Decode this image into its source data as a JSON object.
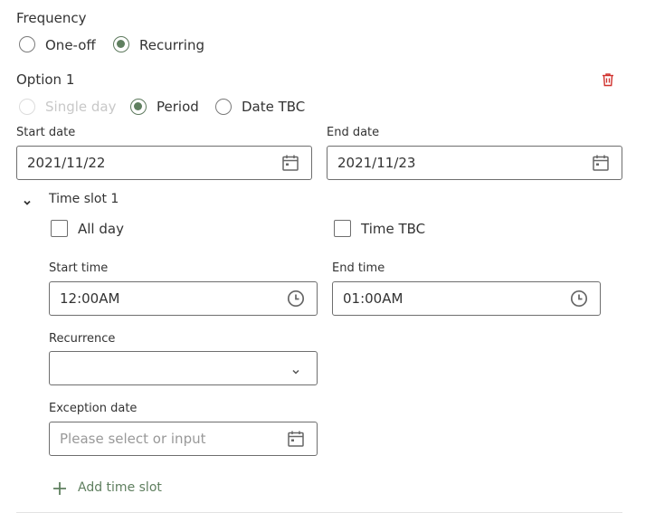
{
  "frequency": {
    "title": "Frequency",
    "options": [
      {
        "label": "One-off",
        "checked": false
      },
      {
        "label": "Recurring",
        "checked": true
      }
    ]
  },
  "option": {
    "title": "Option 1",
    "delete_icon": "trash-icon",
    "day_types": [
      {
        "label": "Single day",
        "checked": false,
        "disabled": true
      },
      {
        "label": "Period",
        "checked": true,
        "disabled": false
      },
      {
        "label": "Date TBC",
        "checked": false,
        "disabled": false
      }
    ],
    "start_date": {
      "label": "Start date",
      "value": "2021/11/22",
      "icon": "calendar-icon"
    },
    "end_date": {
      "label": "End date",
      "value": "2021/11/23",
      "icon": "calendar-icon"
    }
  },
  "time_slot": {
    "title": "Time slot 1",
    "all_day": {
      "label": "All day",
      "checked": false
    },
    "time_tbc": {
      "label": "Time TBC",
      "checked": false
    },
    "start_time": {
      "label": "Start time",
      "value": "12:00AM",
      "icon": "clock-icon"
    },
    "end_time": {
      "label": "End time",
      "value": "01:00AM",
      "icon": "clock-icon"
    },
    "recurrence": {
      "label": "Recurrence",
      "value": ""
    },
    "exception_date": {
      "label": "Exception date",
      "placeholder": "Please select or input",
      "icon": "calendar-icon"
    },
    "add_time_slot": "Add time slot"
  },
  "colors": {
    "accent_green": "#5f7f5f",
    "delete_red": "#d0312d"
  }
}
